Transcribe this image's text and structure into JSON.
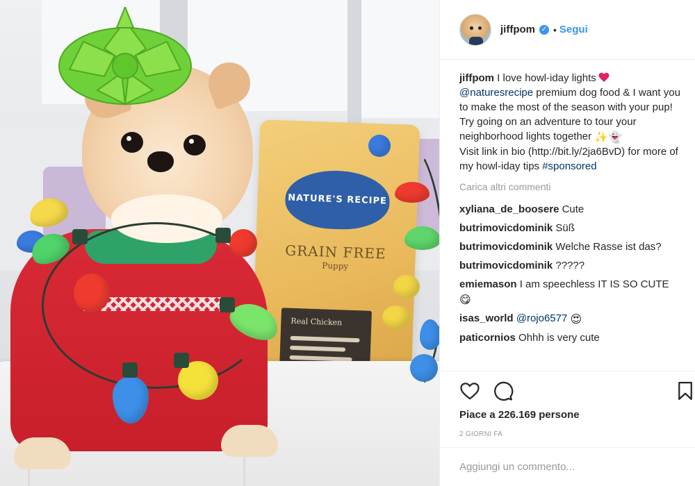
{
  "post": {
    "author": "jiffpom",
    "follow_label": "Segui",
    "separator": "•",
    "caption": {
      "line1": "I love howl-iday lights",
      "mention": "@naturesrecipe",
      "line2": "premium dog food & I want you to make the most of the season with your pup! Try going on an adventure to tour your neighborhood lights together",
      "line3_pre": "Visit link in bio (http://bit.ly/2ja6BvD) for more of my howl-iday tips",
      "hashtag": "#sponsored"
    },
    "load_more_label": "Carica altri commenti",
    "comments": [
      {
        "user": "xyliana_de_boosere",
        "text": "Cute"
      },
      {
        "user": "butrimovicdominik",
        "text": "Süß"
      },
      {
        "user": "butrimovicdominik",
        "text": "Welche Rasse ist das?"
      },
      {
        "user": "butrimovicdominik",
        "text": "?????"
      },
      {
        "user": "emiemason",
        "text": "I am speechless IT IS SO CUTE"
      },
      {
        "user": "isas_world",
        "mention": "@rojo6577",
        "text": ""
      },
      {
        "user": "paticornios",
        "text": "Ohhh is very cute"
      }
    ],
    "likes_label": "Piace a 226.169 persone",
    "time_label": "2 GIORNI FA",
    "add_comment_placeholder": "Aggiungi un commento..."
  },
  "photo_text": {
    "bag_brand": "NATURE'S RECIPE",
    "bag_line1": "GRAIN FREE",
    "bag_line2": "Puppy",
    "bag_box": "Real Chicken"
  },
  "icons": {
    "heart": "heart-outline-icon",
    "comment": "comment-icon",
    "bookmark": "bookmark-icon",
    "verified": "verified-badge-icon"
  },
  "colors": {
    "accent": "#3897f0",
    "link": "#003569",
    "muted": "#999999"
  }
}
